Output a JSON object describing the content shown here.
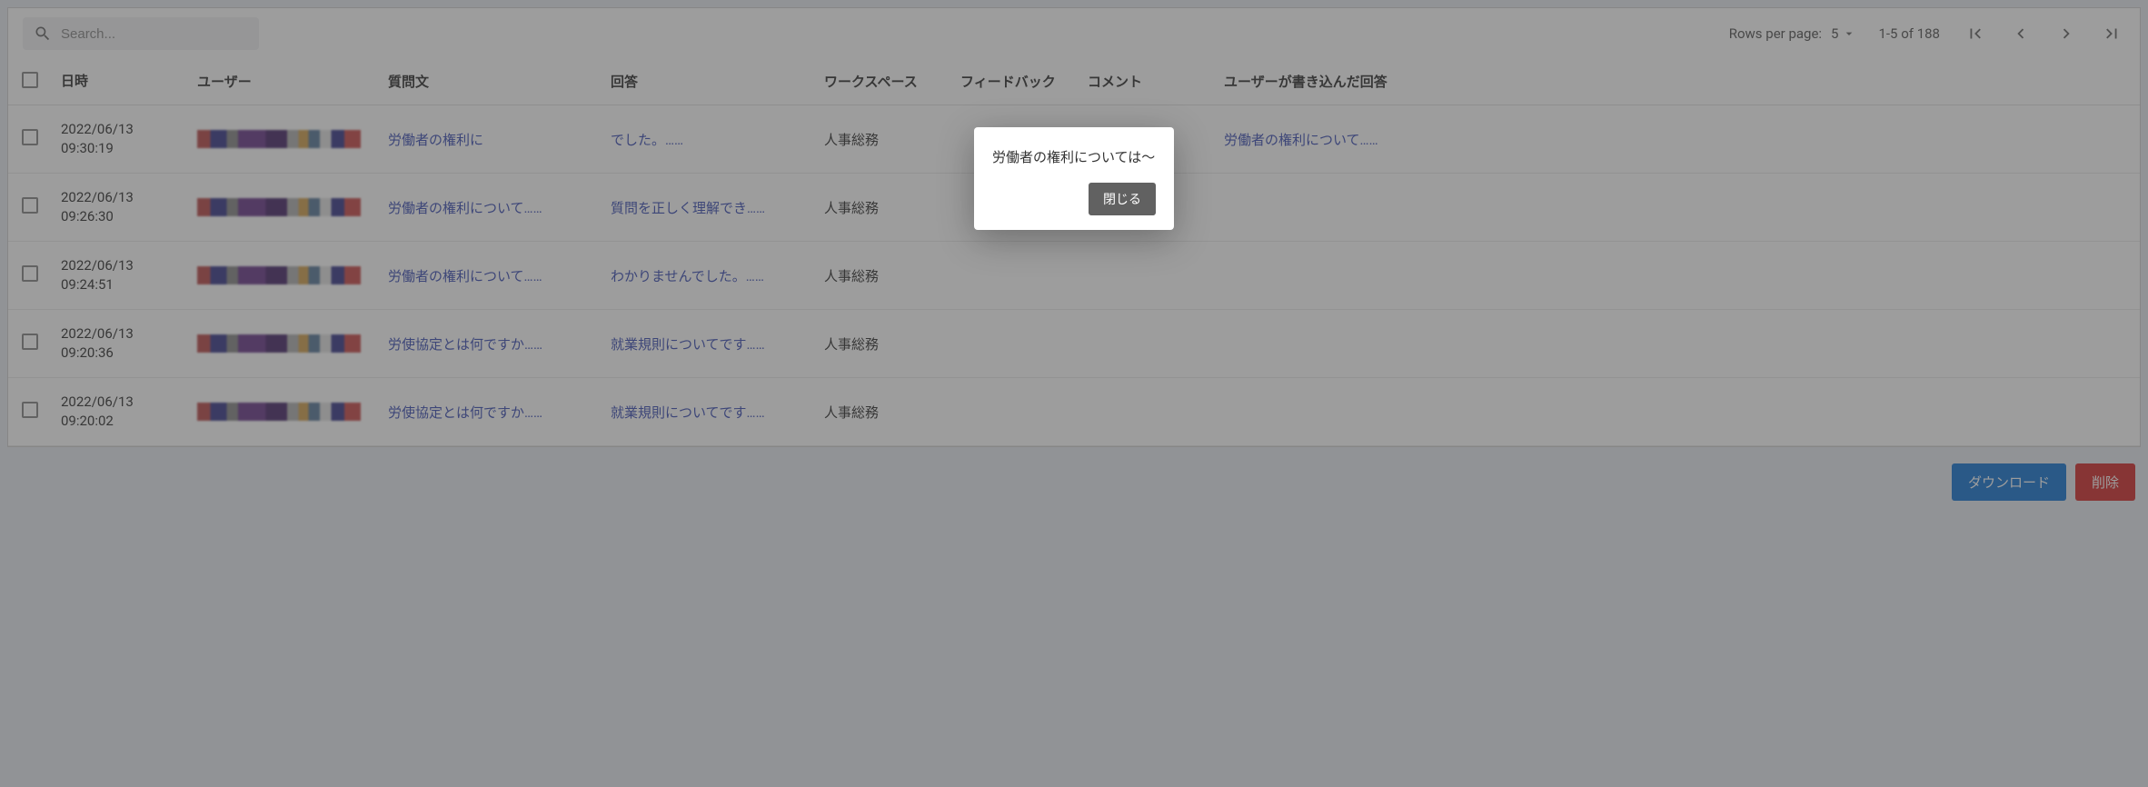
{
  "search": {
    "placeholder": "Search..."
  },
  "pagination": {
    "rows_label": "Rows per page:",
    "rows_value": "5",
    "range": "1-5 of 188"
  },
  "columns": {
    "datetime": "日時",
    "user": "ユーザー",
    "question": "質問文",
    "answer": "回答",
    "workspace": "ワークスペース",
    "feedback": "フィードバック",
    "comment": "コメント",
    "user_answer": "ユーザーが書き込んだ回答"
  },
  "rows": [
    {
      "datetime": "2022/06/13\n09:30:19",
      "question": "労働者の権利に",
      "answer": "でした。……",
      "workspace": "人事総務",
      "user_answer": "労働者の権利について……"
    },
    {
      "datetime": "2022/06/13\n09:26:30",
      "question": "労働者の権利について……",
      "answer": "質問を正しく理解でき……",
      "workspace": "人事総務",
      "user_answer": ""
    },
    {
      "datetime": "2022/06/13\n09:24:51",
      "question": "労働者の権利について……",
      "answer": "わかりませんでした。……",
      "workspace": "人事総務",
      "user_answer": ""
    },
    {
      "datetime": "2022/06/13\n09:20:36",
      "question": "労使協定とは何ですか……",
      "answer": "就業規則についてです……",
      "workspace": "人事総務",
      "user_answer": ""
    },
    {
      "datetime": "2022/06/13\n09:20:02",
      "question": "労使協定とは何ですか……",
      "answer": "就業規則についてです……",
      "workspace": "人事総務",
      "user_answer": ""
    }
  ],
  "actions": {
    "download": "ダウンロード",
    "delete": "削除"
  },
  "modal": {
    "text": "労働者の権利については～",
    "close": "閉じる"
  }
}
